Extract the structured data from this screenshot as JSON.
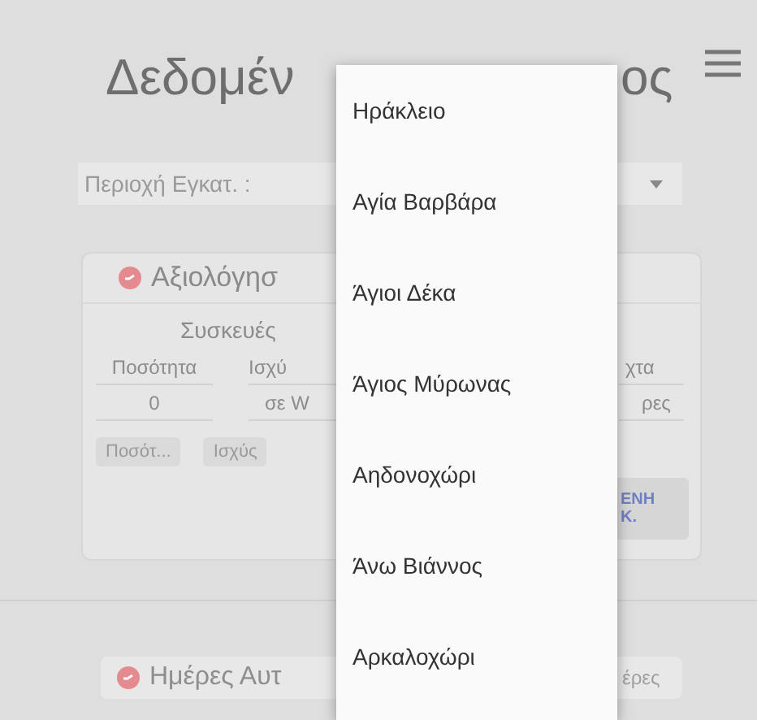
{
  "header": {
    "title_parts": [
      "Δεδομέν",
      "ος"
    ]
  },
  "region_select": {
    "label": "Περιοχή Εγκατ. :"
  },
  "rating_card": {
    "title": "Αξιολόγησ",
    "group": "Συσκευές",
    "columns": [
      "Ποσότητα",
      "Ισχύ",
      "χτα"
    ],
    "values": [
      "0",
      "σε W",
      "ρες"
    ],
    "chips": [
      "Ποσότ...",
      "Ισχύς"
    ],
    "action": "ΕΝΗ\nΚ."
  },
  "days_chip": {
    "label": "Ημέρες Αυτ",
    "value": "έρες"
  },
  "menu": {
    "items": [
      {
        "label": "Ηράκλειο"
      },
      {
        "label": "Αγία Βαρβάρα"
      },
      {
        "label": "Άγιοι Δέκα"
      },
      {
        "label": "Άγιος Μύρωνας"
      },
      {
        "label": "Αηδονοχώρι"
      },
      {
        "label": "Άνω Βιάννος"
      },
      {
        "label": "Αρκαλοχώρι"
      }
    ]
  }
}
